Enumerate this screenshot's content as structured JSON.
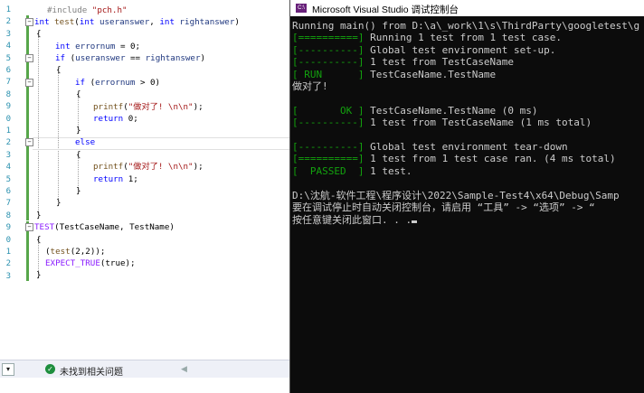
{
  "editor": {
    "line_numbers": [
      "1",
      "2",
      "3",
      "4",
      "5",
      "6",
      "7",
      "8",
      "9",
      "0",
      "1",
      "2",
      "3",
      "4",
      "5",
      "6",
      "7",
      "8",
      "9",
      "0",
      "1",
      "2",
      "3"
    ],
    "code": {
      "l1_pp": "#include ",
      "l1_str": "\"pch.h\"",
      "l2_kw1": "int",
      "l2_fn": " test",
      "l2_rest1": "(",
      "l2_kw2": "int",
      "l2_var1": " useranswer",
      "l2_comma": ", ",
      "l2_kw3": "int",
      "l2_var2": " rightanswer",
      "l2_close": ")",
      "l3": "{",
      "l4_kw": "int",
      "l4_var": " errornum",
      "l4_rest": " = 0;",
      "l5_kw": "if",
      "l5_open": " (",
      "l5_var1": "useranswer",
      "l5_eq": " == ",
      "l5_var2": "rightanswer",
      "l5_close": ")",
      "l6": "{",
      "l7_kw": "if",
      "l7_open": " (",
      "l7_var": "errornum",
      "l7_rest": " > 0)",
      "l8": "{",
      "l9_fn": "printf",
      "l9_open": "(",
      "l9_str": "\"做对了! \\n\\n\"",
      "l9_close": ");",
      "l10_kw": "return",
      "l10_rest": " 0;",
      "l11": "}",
      "l12_kw": "else",
      "l13": "{",
      "l14_fn": "printf",
      "l14_open": "(",
      "l14_str": "\"做对了! \\n\\n\"",
      "l14_close": ");",
      "l15_kw": "return",
      "l15_rest": " 1;",
      "l16": "}",
      "l17": "}",
      "l18": "}",
      "l19_mac": "TEST",
      "l19_rest": "(TestCaseName, TestName)",
      "l20": "{",
      "l21_open": "(",
      "l21_fn": "test",
      "l21_rest": "(2,2));",
      "l22_mac": "EXPECT_TRUE",
      "l22_rest": "(true);",
      "l23": "}"
    }
  },
  "statusbar": {
    "message": "未找到相关问题",
    "zoom_icon": "dropdown-icon",
    "ok_icon": "check-circle-icon"
  },
  "console": {
    "title": "Microsoft Visual Studio 调试控制台",
    "app_icon_text": "C:\\",
    "lines": [
      {
        "tag": "",
        "text": "Running main() from D:\\a\\_work\\1\\s\\ThirdParty\\googletest\\g"
      },
      {
        "tag": "[==========]",
        "text": " Running 1 test from 1 test case."
      },
      {
        "tag": "[----------]",
        "text": " Global test environment set-up."
      },
      {
        "tag": "[----------]",
        "text": " 1 test from TestCaseName"
      },
      {
        "tag": "[ RUN      ]",
        "text": " TestCaseName.TestName"
      },
      {
        "tag": "",
        "text": "做对了!"
      },
      {
        "tag": "",
        "text": ""
      },
      {
        "tag": "[       OK ]",
        "text": " TestCaseName.TestName (0 ms)"
      },
      {
        "tag": "[----------]",
        "text": " 1 test from TestCaseName (1 ms total)"
      },
      {
        "tag": "",
        "text": ""
      },
      {
        "tag": "[----------]",
        "text": " Global test environment tear-down"
      },
      {
        "tag": "[==========]",
        "text": " 1 test from 1 test case ran. (4 ms total)"
      },
      {
        "tag": "[  PASSED  ]",
        "text": " 1 test."
      },
      {
        "tag": "",
        "text": ""
      },
      {
        "tag": "",
        "text": "D:\\沈航-软件工程\\程序设计\\2022\\Sample-Test4\\x64\\Debug\\Samp"
      },
      {
        "tag": "",
        "text": "要在调试停止时自动关闭控制台，请启用 “工具” -> “选项” -> “"
      },
      {
        "tag": "",
        "text": "按任意键关闭此窗口. . ."
      }
    ]
  }
}
